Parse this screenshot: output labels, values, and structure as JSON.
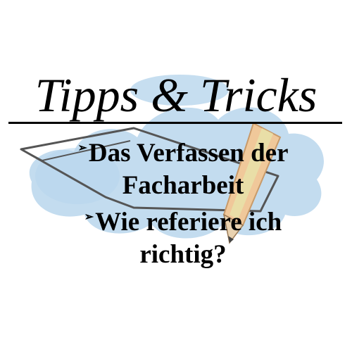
{
  "title": "Tipps & Tricks",
  "bullet_symbol": "➢",
  "items": [
    {
      "line1": "Das Verfassen der",
      "line2": "Facharbeit"
    },
    {
      "line1": "Wie referiere ich",
      "line2": "richtig?"
    }
  ],
  "colors": {
    "text": "#000000",
    "cloud": "#b8d6ec",
    "pencil_body": "#f0c89a",
    "pencil_accent": "#e8e0a8",
    "paper_outline": "#555555"
  },
  "illustration": {
    "objects": [
      "paper-sheet",
      "pencil",
      "blue-cloud-shape"
    ]
  }
}
